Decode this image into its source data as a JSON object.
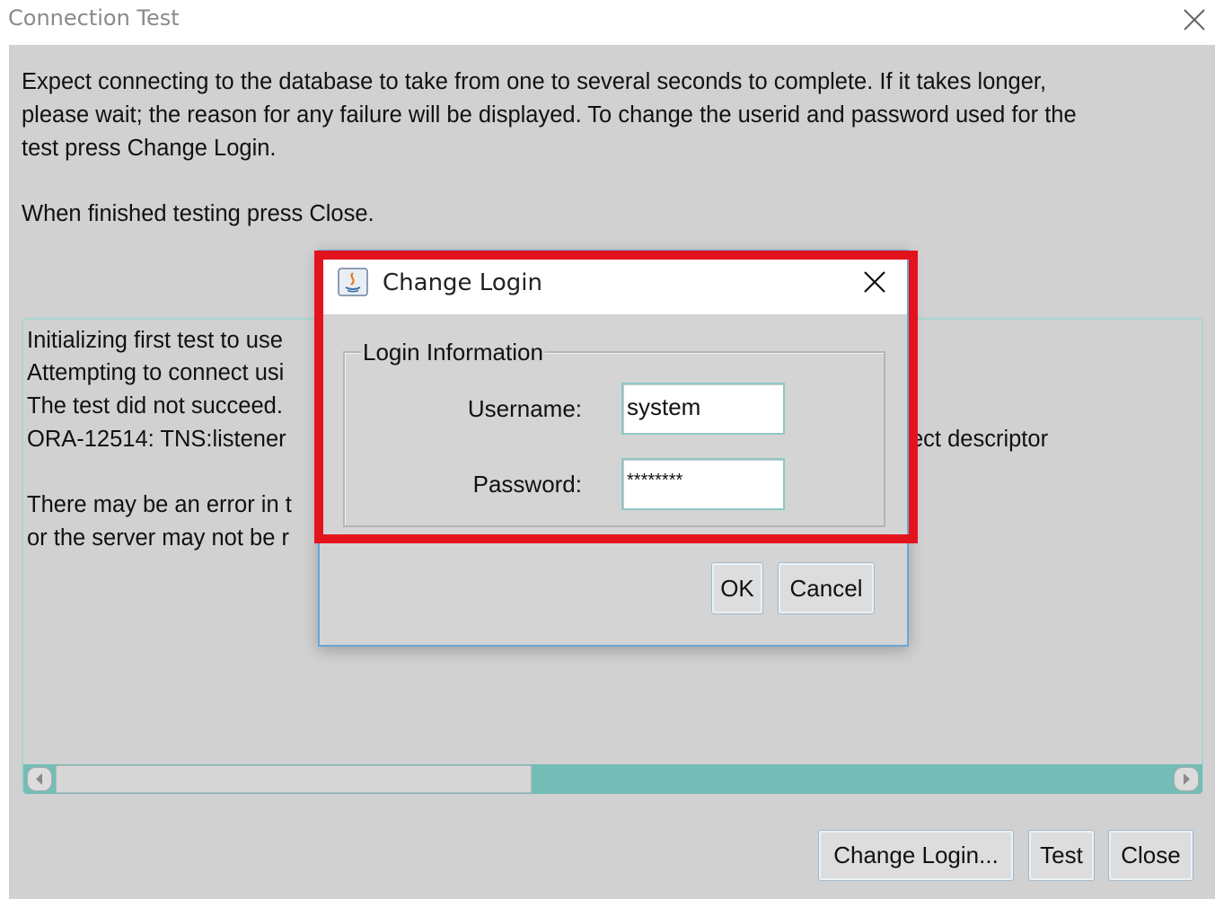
{
  "window": {
    "title": "Connection Test",
    "close_icon": "close-icon"
  },
  "message": {
    "line1": "Expect connecting to the database to take from one to several seconds to complete. If it takes longer,",
    "line2": "please wait; the reason for any failure will be displayed. To change the userid and password used for the",
    "line3": "test press Change Login.",
    "line4": "When finished testing press Close."
  },
  "log": {
    "lines": [
      "Initializing first test to use",
      "Attempting to connect usi",
      "The test did not succeed.",
      "ORA-12514: TNS:listener",
      "",
      "There may be an error in t",
      "or the server may not be r"
    ],
    "right_fragment": "ect descriptor"
  },
  "buttons": {
    "change_login": "Change Login...",
    "test": "Test",
    "close": "Close"
  },
  "dialog": {
    "title": "Change Login",
    "group_label": "Login Information",
    "username_label": "Username:",
    "username_value": "system",
    "password_label": "Password:",
    "password_value": "********",
    "ok": "OK",
    "cancel": "Cancel"
  },
  "colors": {
    "highlight": "#e3131e",
    "scroll_accent": "#73bdb6"
  }
}
